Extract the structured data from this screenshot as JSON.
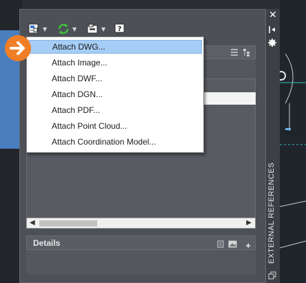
{
  "toolbar": {
    "attach_icon": "attach-reference-icon",
    "refresh_icon": "refresh-icon",
    "change_path_icon": "change-path-icon",
    "help_icon": "help-icon"
  },
  "menu": {
    "items": [
      {
        "label": "Attach DWG..."
      },
      {
        "label": "Attach Image..."
      },
      {
        "label": "Attach DWF..."
      },
      {
        "label": "Attach DGN..."
      },
      {
        "label": "Attach PDF..."
      },
      {
        "label": "Attach Point Cloud..."
      },
      {
        "label": "Attach Coordination Model..."
      }
    ],
    "selected_index": 0
  },
  "details": {
    "title": "Details"
  },
  "palette": {
    "vertical_title": "EXTERNAL REFERENCES"
  },
  "colors": {
    "callout": "#f07e26",
    "menu_highlight": "#a6cdf5",
    "palette_bg": "#4d5157",
    "backdrop_blue": "#4a7fbf"
  }
}
